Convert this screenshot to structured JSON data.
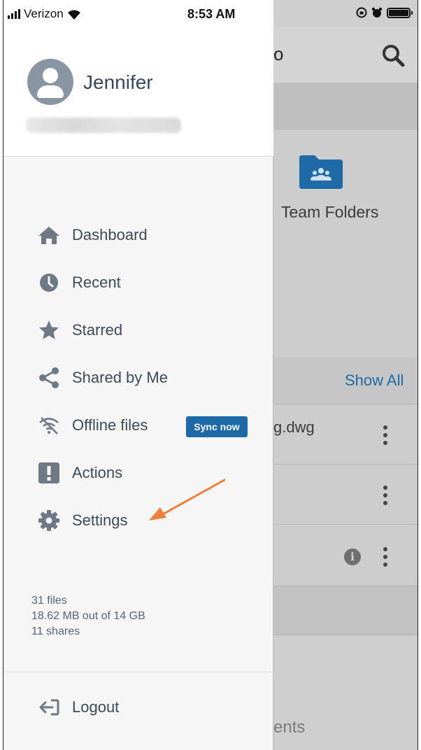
{
  "status_bar": {
    "carrier": "Verizon",
    "time": "8:53 AM"
  },
  "profile": {
    "name": "Jennifer"
  },
  "menu": [
    {
      "label": "Dashboard",
      "icon": "home-icon"
    },
    {
      "label": "Recent",
      "icon": "clock-icon"
    },
    {
      "label": "Starred",
      "icon": "star-icon"
    },
    {
      "label": "Shared by Me",
      "icon": "share-icon"
    },
    {
      "label": "Offline files",
      "icon": "wifi-off-icon",
      "badge": "Sync now"
    },
    {
      "label": "Actions",
      "icon": "exclamation-icon"
    },
    {
      "label": "Settings",
      "icon": "gear-icon"
    }
  ],
  "stats": {
    "files": "31 files",
    "storage": "18.62 MB out of 14 GB",
    "shares": "11 shares"
  },
  "logout": {
    "label": "Logout"
  },
  "background": {
    "title_fragment": "o",
    "team_folders": "Team Folders",
    "show_all": "Show All",
    "file_fragment": "g.dwg",
    "bottom_fragment": "ents"
  },
  "colors": {
    "accent": "#1d6aa6",
    "annotation_arrow": "#f07f3c",
    "icon_gray": "#6f7985"
  }
}
